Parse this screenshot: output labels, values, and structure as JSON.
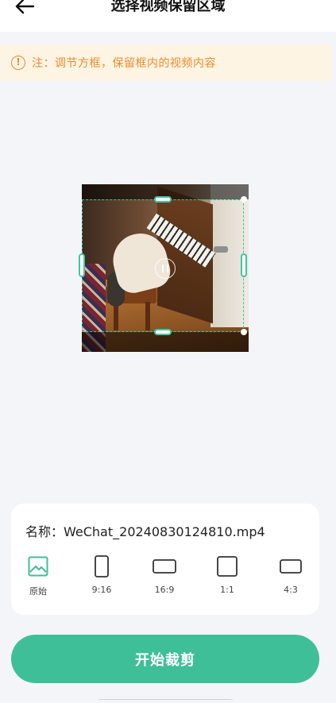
{
  "header": {
    "title": "选择视频保留区域",
    "back_icon": "arrow-left-icon"
  },
  "notice": {
    "icon_symbol": "!",
    "text": "注：调节方框，保留框内的视频内容",
    "color": "#e88c2e",
    "background": "#fdf4e3"
  },
  "panel": {
    "file_label": "名称：",
    "file_name": "WeChat_20240830124810.mp4",
    "ratios": [
      {
        "label": "原始",
        "icon": "image-icon",
        "selected": true
      },
      {
        "label": "9:16",
        "icon": "portrait-rect-icon",
        "selected": false
      },
      {
        "label": "16:9",
        "icon": "landscape-rect-icon",
        "selected": false
      },
      {
        "label": "1:1",
        "icon": "square-icon",
        "selected": false
      },
      {
        "label": "4:3",
        "icon": "landscape-rect-icon",
        "selected": false
      }
    ]
  },
  "action": {
    "start_label": "开始裁剪"
  },
  "colors": {
    "accent": "#3ebf98",
    "crop_border": "#3fc79d",
    "page_bg": "#f4f5f9"
  }
}
